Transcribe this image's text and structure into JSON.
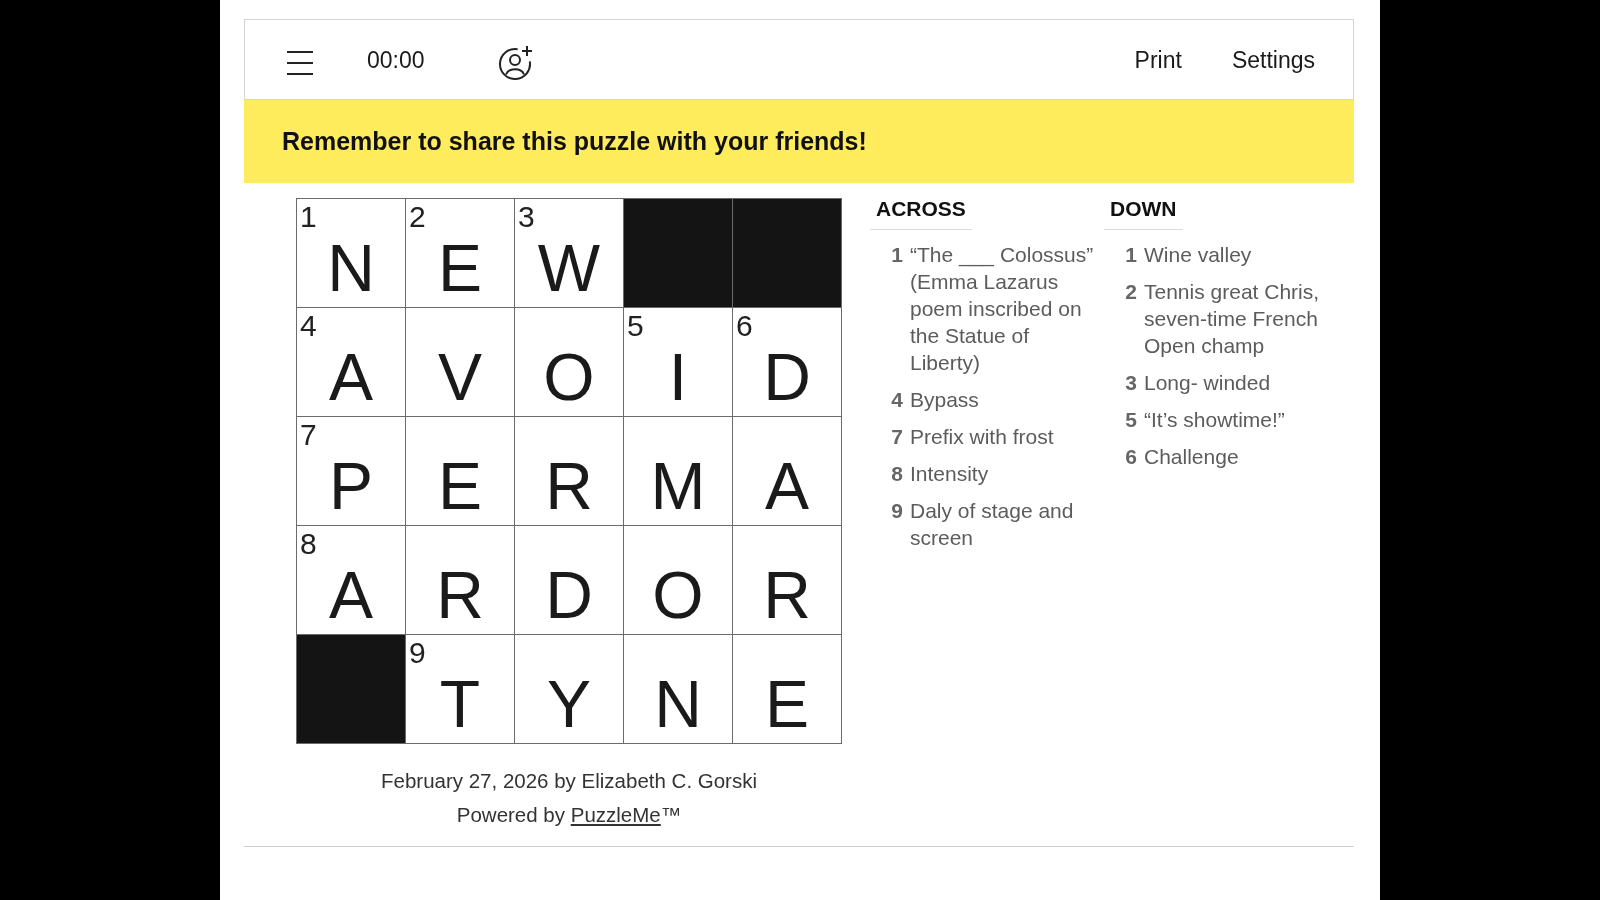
{
  "toolbar": {
    "timer": "00:00",
    "actions": [
      "Print",
      "Settings"
    ]
  },
  "banner": {
    "message": "Remember to share this puzzle with your friends!"
  },
  "grid": {
    "rows": [
      [
        {
          "kind": "letter",
          "number": "1",
          "letter": "N"
        },
        {
          "kind": "letter",
          "number": "2",
          "letter": "E"
        },
        {
          "kind": "letter",
          "number": "3",
          "letter": "W"
        },
        {
          "kind": "block"
        },
        {
          "kind": "block"
        }
      ],
      [
        {
          "kind": "letter",
          "number": "4",
          "letter": "A"
        },
        {
          "kind": "letter",
          "letter": "V"
        },
        {
          "kind": "letter",
          "letter": "O"
        },
        {
          "kind": "letter",
          "number": "5",
          "letter": "I"
        },
        {
          "kind": "letter",
          "number": "6",
          "letter": "D"
        }
      ],
      [
        {
          "kind": "letter",
          "number": "7",
          "letter": "P"
        },
        {
          "kind": "letter",
          "letter": "E"
        },
        {
          "kind": "letter",
          "letter": "R"
        },
        {
          "kind": "letter",
          "letter": "M"
        },
        {
          "kind": "letter",
          "letter": "A"
        }
      ],
      [
        {
          "kind": "letter",
          "number": "8",
          "letter": "A"
        },
        {
          "kind": "letter",
          "letter": "R"
        },
        {
          "kind": "letter",
          "letter": "D"
        },
        {
          "kind": "letter",
          "letter": "O"
        },
        {
          "kind": "letter",
          "letter": "R"
        }
      ],
      [
        {
          "kind": "block"
        },
        {
          "kind": "letter",
          "number": "9",
          "letter": "T"
        },
        {
          "kind": "letter",
          "letter": "Y"
        },
        {
          "kind": "letter",
          "letter": "N"
        },
        {
          "kind": "letter",
          "letter": "E"
        }
      ]
    ]
  },
  "clue_lists": [
    {
      "heading": "ACROSS",
      "clues": [
        {
          "number": "1",
          "text": "“The ___ Colossus” (Emma Lazarus poem inscribed on the Statue of Liberty)"
        },
        {
          "number": "4",
          "text": "Bypass"
        },
        {
          "number": "7",
          "text": "Prefix with frost"
        },
        {
          "number": "8",
          "text": "Intensity"
        },
        {
          "number": "9",
          "text": "Daly of stage and screen"
        }
      ]
    },
    {
      "heading": "DOWN",
      "clues": [
        {
          "number": "1",
          "text": "Wine valley"
        },
        {
          "number": "2",
          "text": "Tennis great Chris, seven-time French Open champ"
        },
        {
          "number": "3",
          "text": "Long- winded"
        },
        {
          "number": "5",
          "text": "“It’s showtime!”"
        },
        {
          "number": "6",
          "text": "Challenge"
        }
      ]
    }
  ],
  "footer": {
    "byline": "February 27, 2026 by Elizabeth C. Gorski",
    "credit": {
      "prefix": "Powered by",
      "link": "PuzzleMe",
      "suffix": "™"
    }
  }
}
